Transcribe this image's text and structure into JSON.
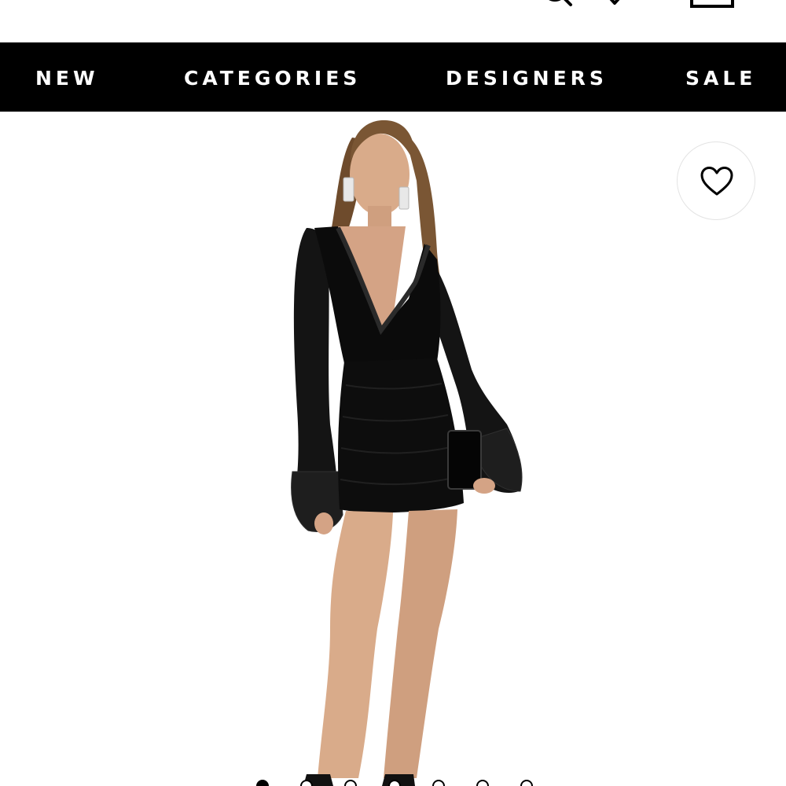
{
  "header": {
    "icons": [
      "search-icon",
      "heart-icon",
      "bag-icon"
    ]
  },
  "nav": {
    "items": [
      {
        "label": "NEW"
      },
      {
        "label": "CATEGORIES"
      },
      {
        "label": "DESIGNERS"
      },
      {
        "label": "SALE"
      }
    ],
    "background": "#000000",
    "text_color": "#ffffff"
  },
  "product": {
    "image_alt_icon": "model-photo",
    "wishlist_icon": "heart-outline-icon",
    "carousel": {
      "total": 7,
      "active_index": 1
    }
  },
  "colors": {
    "dress": "#0b0b0b",
    "skin": "#d9ab8a",
    "hair": "#7a5634"
  }
}
